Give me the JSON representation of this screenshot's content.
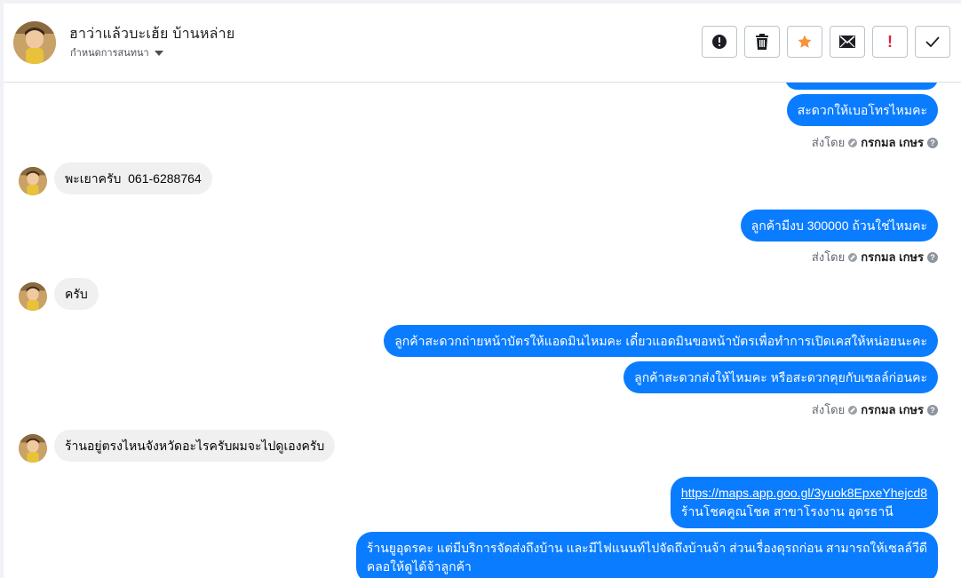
{
  "header": {
    "contact_name": "ฮาว่าแล้วบะเฮ้ย บ้านหล่าย",
    "assign_label": "กำหนดการสนทนา",
    "actions": [
      "report",
      "delete",
      "star",
      "mail",
      "spam",
      "done"
    ],
    "action_symbols": {
      "spam": "!"
    }
  },
  "messages": [
    {
      "dir": "out",
      "text": ""
    },
    {
      "dir": "out",
      "text": "สะดวกให้เบอโทรไหมคะ"
    },
    {
      "dir": "meta",
      "sent_by": "ส่งโดย",
      "agent": "กรกมล เกษร"
    },
    {
      "dir": "in",
      "text": "พะเยาครับ  061-6288764"
    },
    {
      "dir": "out",
      "text": "ลูกค้ามีงบ 300000 ถ้วนใช่ไหมคะ"
    },
    {
      "dir": "meta",
      "sent_by": "ส่งโดย",
      "agent": "กรกมล เกษร"
    },
    {
      "dir": "in",
      "text": "ครับ"
    },
    {
      "dir": "out",
      "text": "ลูกค้าสะดวกถ่ายหน้าบัตรให้แอดมินไหมคะ เดี๋ยวแอดมินขอหน้าบัตรเพื่อทำการเปิดเคสให้หน่อยนะคะ"
    },
    {
      "dir": "out",
      "text": "ลูกค้าสะดวกส่งให้ไหมคะ หรือสะดวกคุยกับเซลล์ก่อนคะ"
    },
    {
      "dir": "meta",
      "sent_by": "ส่งโดย",
      "agent": "กรกมล เกษร"
    },
    {
      "dir": "in",
      "text": "ร้านอยู่ตรงไหนจังหวัดอะไรครับผมจะไปดูเองครับ"
    },
    {
      "dir": "out",
      "link": "https://maps.app.goo.gl/3yuok8EpxeYhejcd8",
      "text": "ร้านโชคคูณโชค สาขาโรงงาน อุดรธานี"
    },
    {
      "dir": "out",
      "line1": "ร้านยูอุดรคะ แต่มีบริการจัดส่งถึงบ้าน และมีไฟแนนท์ไปจัดถึงบ้านจ้า ส่วนเรื่องดุรถก่อน สามารถให้เซลล์วีดี",
      "line2": "คลอให้ดูได้จ้าลูกค้า"
    }
  ],
  "colors": {
    "outgoing": "#0a7cff",
    "incoming": "#f0f0f0",
    "star": "#f7923a",
    "spam": "#e41e3f"
  }
}
